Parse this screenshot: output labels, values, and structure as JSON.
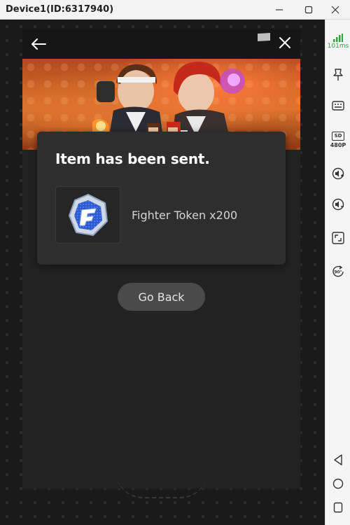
{
  "window": {
    "title": "Device1(ID:6317940)"
  },
  "sidebar": {
    "signal_text": "101ms",
    "resolution_badge": "SD",
    "resolution_text": "480P",
    "rotate_text": "90°",
    "items": [
      {
        "name": "signal-icon"
      },
      {
        "name": "pin-icon"
      },
      {
        "name": "keyboard-icon"
      },
      {
        "name": "resolution-icon"
      },
      {
        "name": "volume-up-icon"
      },
      {
        "name": "volume-down-icon"
      },
      {
        "name": "screenshot-icon"
      },
      {
        "name": "rotate-icon"
      },
      {
        "name": "nav-back-icon"
      },
      {
        "name": "nav-home-icon"
      },
      {
        "name": "nav-recents-icon"
      }
    ]
  },
  "dialog": {
    "title": "Item has been sent.",
    "item_label": "Fighter Token x200",
    "item_icon": "fighter-token-icon"
  },
  "actions": {
    "go_back_label": "Go Back"
  },
  "colors": {
    "panel_bg": "#222222",
    "dialog_bg": "#2e2e2e",
    "button_bg": "#4a4a4a",
    "signal_green": "#2ea043"
  }
}
